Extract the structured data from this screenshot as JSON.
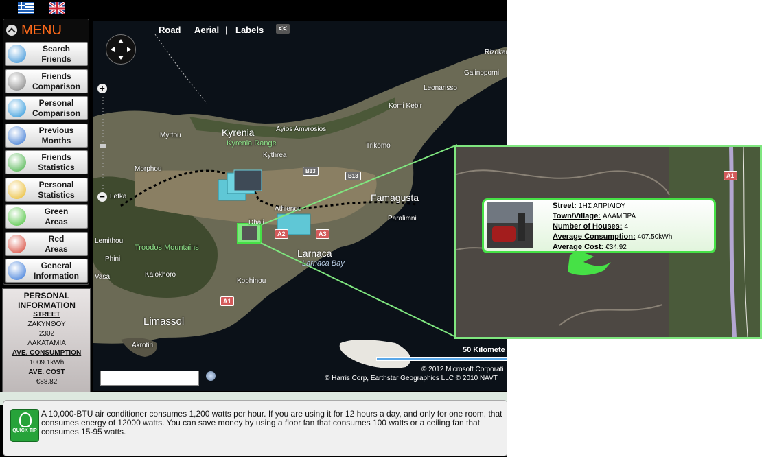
{
  "flags": {
    "greek": "greek-flag",
    "english": "uk-flag"
  },
  "menu": {
    "title": "MENU",
    "items": [
      {
        "line1": "Search",
        "line2": "Friends",
        "icon": "search-friends-icon",
        "color": "#2a8ad4"
      },
      {
        "line1": "Friends",
        "line2": "Comparison",
        "icon": "friends-comparison-icon",
        "color": "#7a7a7a"
      },
      {
        "line1": "Personal",
        "line2": "Comparison",
        "icon": "home-icon",
        "color": "#1d8fd8"
      },
      {
        "line1": "Previous",
        "line2": "Months",
        "icon": "calendar-icon",
        "color": "#2d6fd1"
      },
      {
        "line1": "Friends",
        "line2": "Statistics",
        "icon": "friends-statistics-icon",
        "color": "#3fae3f"
      },
      {
        "line1": "Personal",
        "line2": "Statistics",
        "icon": "pie-chart-icon",
        "color": "#e8b620"
      },
      {
        "line1": "Green",
        "line2": "Areas",
        "icon": "green-leaf-icon",
        "color": "#3fbf2f"
      },
      {
        "line1": "Red",
        "line2": "Areas",
        "icon": "red-leaf-icon",
        "color": "#d43a2a"
      },
      {
        "line1": "General",
        "line2": "Information",
        "icon": "info-icon",
        "color": "#2b6fd6"
      }
    ]
  },
  "personal_info": {
    "title": "PERSONAL INFORMATION",
    "street_label": "STREET",
    "street_line1": "ΖΑΚΥΝΘΟΥ",
    "street_line2": "2302",
    "street_line3": "ΛΑΚΑΤΑΜΙΑ",
    "consumption_label": "AVE. CONSUMPTION",
    "consumption_value": "1009.1kWh",
    "cost_label": "AVE. COST",
    "cost_value": "€88.82"
  },
  "map": {
    "nav": {
      "road": "Road",
      "aerial": "Aerial",
      "labels": "Labels",
      "collapse": "<<"
    },
    "labels": {
      "kyrenia": "Kyrenia",
      "kyrenia_range": "Kyrenia Range",
      "ayios_amvrosios": "Ayios Amvrosios",
      "myrtou": "Myrtou",
      "kythrea": "Kythrea",
      "morphou": "Morphou",
      "lefka": "Lefka",
      "trikomo": "Trikomo",
      "famagusta": "Famagusta",
      "paralimni": "Paralimni",
      "athienou": "Athienou",
      "dhali": "Dhali",
      "leonarisso": "Leonarisso",
      "komi_kebir": "Komi Kebir",
      "galinoporni": "Galinoporni",
      "rizokarpaso": "Rizokar",
      "lemithou": "Lemithou",
      "troodos": "Troodos Mountains",
      "phini": "Phini",
      "kalokhoro": "Kalokhoro",
      "kophinou": "Kophinou",
      "larnaca": "Larnaca",
      "larnaca_bay": "Larnaca Bay",
      "vasa": "Vasa",
      "limassol": "Limassol",
      "akrotiri": "Akrotiri"
    },
    "roads": {
      "b13a": "B13",
      "b13b": "B13",
      "a3": "A3",
      "a1": "A1",
      "a2": "A2"
    },
    "scale": "50 Kilomete",
    "copyright1": "© 2012 Microsoft Corporati",
    "copyright2": "© Harris Corp, Earthstar Geographics LLC  © 2010 NAVT",
    "search_placeholder": ""
  },
  "popup": {
    "street_label": "Street:",
    "street_value": "1ΗΣ ΑΠΡΙΛΙΟΥ",
    "town_label": "Town/Village:",
    "town_value": "ΑΛΑΜΠΡΑ",
    "houses_label": "Number of Houses:",
    "houses_value": "4",
    "consumption_label": "Average Consumption:",
    "consumption_value": "407.50kWh",
    "cost_label": "Average Cost:",
    "cost_value": "€34.92",
    "road_badge": "A1"
  },
  "tip": {
    "icon_label": "QUICK TIP",
    "text": "A 10,000-BTU air conditioner consumes 1,200 watts per hour. If you are using it for 12 hours a day, and only for one room, that consumes energy of 12000 watts. You can save money by using a floor fan that consumes 100 watts or a ceiling fan that consumes 15-95 watts."
  },
  "colors": {
    "accent_green": "#46e146",
    "menu_orange": "#ff6a1a",
    "highlight": "#7fe67f"
  }
}
